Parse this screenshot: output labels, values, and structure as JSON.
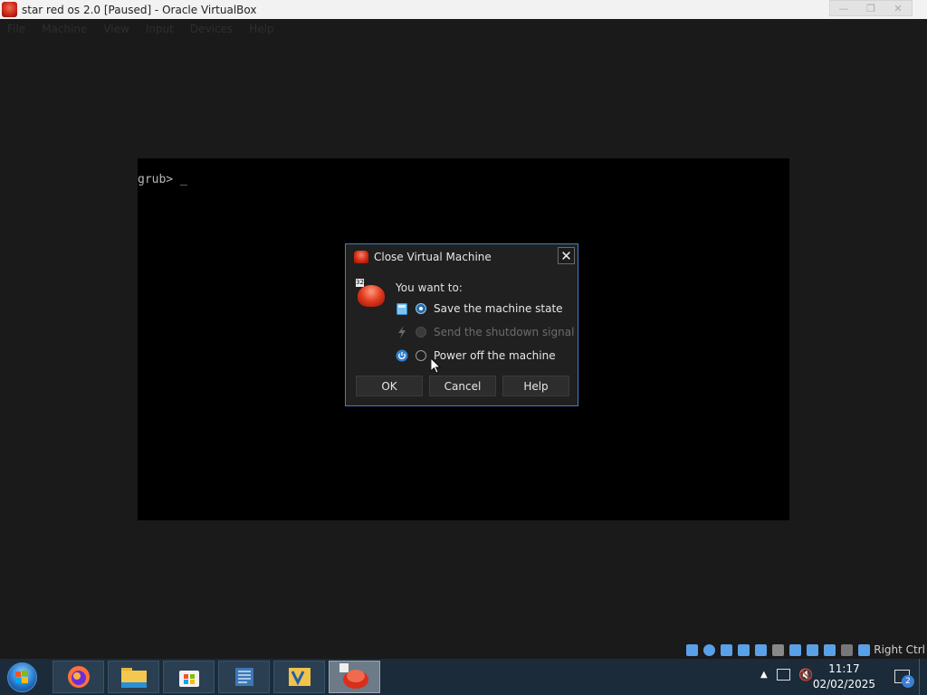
{
  "window": {
    "title": "star red os 2.0 [Paused] - Oracle VirtualBox",
    "controls": [
      "minimize",
      "restore",
      "close"
    ]
  },
  "menubar": {
    "items": [
      "File",
      "Machine",
      "View",
      "Input",
      "Devices",
      "Help"
    ]
  },
  "vm_screen": {
    "text": "grub> _"
  },
  "dialog": {
    "title": "Close Virtual Machine",
    "prompt": "You want to:",
    "options": [
      {
        "label": "Save the machine state",
        "icon": "save-state-icon",
        "state": "checked"
      },
      {
        "label": "Send the shutdown signal",
        "icon": "lightning-icon",
        "state": "disabled"
      },
      {
        "label": "Power off the machine",
        "icon": "power-icon",
        "state": "unchecked"
      }
    ],
    "buttons": {
      "ok": "OK",
      "cancel": "Cancel",
      "help": "Help"
    },
    "big_icon_badge": "32"
  },
  "statusbar": {
    "host_key": "Right Ctrl"
  },
  "taskbar": {
    "apps": [
      "Firefox",
      "File Explorer",
      "Microsoft Store",
      "Notepad++",
      "Visual Studio Code",
      "VirtualBox VM"
    ],
    "clock_time": "11:17",
    "clock_date": "02/02/2025",
    "notification_count": "2"
  }
}
